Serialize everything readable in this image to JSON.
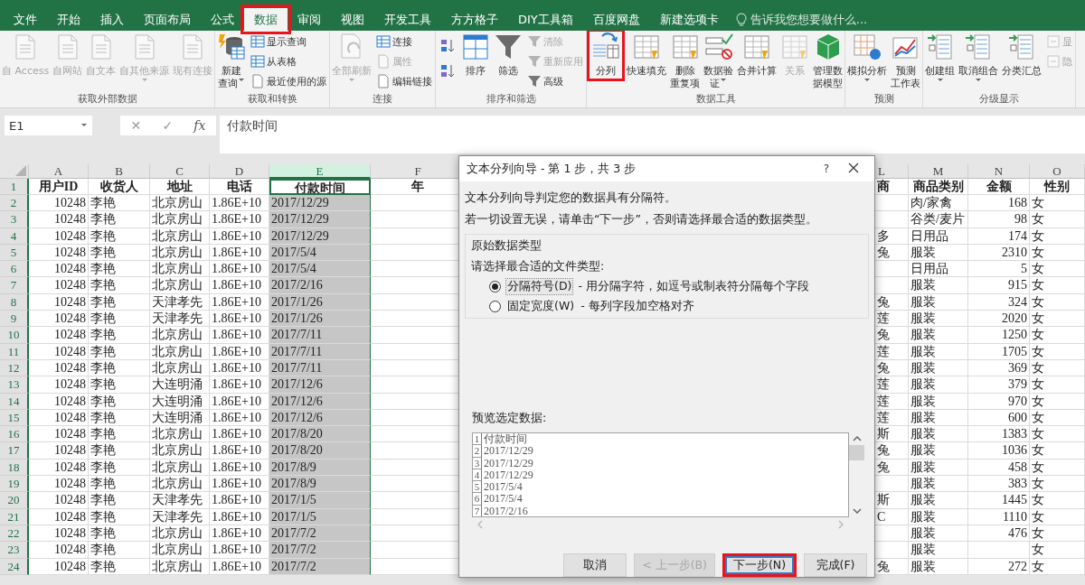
{
  "tabs": [
    {
      "label": "文件",
      "selected": false,
      "highlighted": false
    },
    {
      "label": "开始",
      "selected": false,
      "highlighted": false
    },
    {
      "label": "插入",
      "selected": false,
      "highlighted": false
    },
    {
      "label": "页面布局",
      "selected": false,
      "highlighted": false
    },
    {
      "label": "公式",
      "selected": false,
      "highlighted": false
    },
    {
      "label": "数据",
      "selected": true,
      "highlighted": true
    },
    {
      "label": "审阅",
      "selected": false,
      "highlighted": false
    },
    {
      "label": "视图",
      "selected": false,
      "highlighted": false
    },
    {
      "label": "开发工具",
      "selected": false,
      "highlighted": false
    },
    {
      "label": "方方格子",
      "selected": false,
      "highlighted": false
    },
    {
      "label": "DIY工具箱",
      "selected": false,
      "highlighted": false
    },
    {
      "label": "百度网盘",
      "selected": false,
      "highlighted": false
    },
    {
      "label": "新建选项卡",
      "selected": false,
      "highlighted": false
    }
  ],
  "tell_me": {
    "placeholder": "告诉我您想要做什么..."
  },
  "ribbon": {
    "groups": [
      {
        "label": "获取外部数据",
        "items": [
          {
            "kind": "large",
            "lines": [
              "自 Access"
            ],
            "disabled": true
          },
          {
            "kind": "large",
            "lines": [
              "自网站"
            ],
            "disabled": true
          },
          {
            "kind": "large",
            "lines": [
              "自文本"
            ],
            "disabled": true
          },
          {
            "kind": "large",
            "lines": [
              "自其他来源"
            ],
            "disabled": true,
            "menu": true
          },
          {
            "kind": "large",
            "lines": [
              "现有连接"
            ],
            "disabled": true
          }
        ]
      },
      {
        "label": "获取和转换",
        "items": [
          {
            "kind": "large",
            "lines": [
              "新建",
              "查询"
            ],
            "disabled": false,
            "menu": true
          },
          {
            "kind": "stack",
            "items": [
              {
                "label": "显示查询",
                "disabled": false
              },
              {
                "label": "从表格",
                "disabled": false
              },
              {
                "label": "最近使用的源",
                "disabled": false
              }
            ]
          }
        ]
      },
      {
        "label": "连接",
        "items": [
          {
            "kind": "large",
            "lines": [
              "全部刷新"
            ],
            "disabled": true,
            "menu": true
          },
          {
            "kind": "stack",
            "items": [
              {
                "label": "连接",
                "disabled": false
              },
              {
                "label": "属性",
                "disabled": true
              },
              {
                "label": "编辑链接",
                "disabled": false
              }
            ]
          }
        ]
      },
      {
        "label": "排序和筛选",
        "items": [
          {
            "kind": "sort-icons"
          },
          {
            "kind": "large",
            "lines": [
              "排序"
            ],
            "disabled": false
          },
          {
            "kind": "large",
            "lines": [
              "筛选"
            ],
            "disabled": false
          },
          {
            "kind": "stack",
            "items": [
              {
                "label": "清除",
                "disabled": true
              },
              {
                "label": "重新应用",
                "disabled": true
              },
              {
                "label": "高级",
                "disabled": false
              }
            ]
          }
        ]
      },
      {
        "label": "数据工具",
        "items": [
          {
            "kind": "large",
            "lines": [
              "分列"
            ],
            "disabled": false,
            "highlighted": true
          },
          {
            "kind": "large",
            "lines": [
              "快速填充"
            ],
            "disabled": false
          },
          {
            "kind": "large",
            "lines": [
              "删除",
              "重复项"
            ],
            "disabled": false
          },
          {
            "kind": "large",
            "lines": [
              "数据验",
              "证"
            ],
            "disabled": false,
            "menu": true
          },
          {
            "kind": "large",
            "lines": [
              "合并计算"
            ],
            "disabled": false
          },
          {
            "kind": "large",
            "lines": [
              "关系"
            ],
            "disabled": true
          },
          {
            "kind": "large",
            "lines": [
              "管理数",
              "据模型"
            ],
            "disabled": false
          }
        ]
      },
      {
        "label": "预测",
        "items": [
          {
            "kind": "large",
            "lines": [
              "模拟分析"
            ],
            "disabled": false,
            "menu": true
          },
          {
            "kind": "large",
            "lines": [
              "预测",
              "工作表"
            ],
            "disabled": false
          }
        ]
      },
      {
        "label": "分级显示",
        "items": [
          {
            "kind": "large",
            "lines": [
              "创建组"
            ],
            "disabled": false,
            "menu": true
          },
          {
            "kind": "large",
            "lines": [
              "取消组合"
            ],
            "disabled": false,
            "menu": true
          },
          {
            "kind": "large",
            "lines": [
              "分类汇总"
            ],
            "disabled": false
          },
          {
            "kind": "stack",
            "items": [
              {
                "label": "显",
                "disabled": true
              },
              {
                "label": "隐",
                "disabled": true
              }
            ]
          }
        ]
      }
    ]
  },
  "formula_bar": {
    "name_box": "E1",
    "cancel": "✕",
    "enter": "✓",
    "function": "fx",
    "value": "付款时间"
  },
  "sheet": {
    "columns": [
      {
        "letter": "A",
        "selected": false,
        "numeric": true
      },
      {
        "letter": "B",
        "selected": false
      },
      {
        "letter": "C",
        "selected": false
      },
      {
        "letter": "D",
        "selected": false
      },
      {
        "letter": "E",
        "selected": true
      },
      {
        "letter": "F",
        "selected": false
      },
      {
        "letter": "L",
        "selected": false,
        "cut_off": true
      },
      {
        "letter": "M",
        "selected": false
      },
      {
        "letter": "N",
        "selected": false,
        "numeric": true
      },
      {
        "letter": "O",
        "selected": false
      }
    ],
    "rows": [
      {
        "number": "1",
        "kind": "header",
        "cells": [
          "用户ID",
          "收货人",
          "地址",
          "电话",
          "付款时间",
          "年",
          "商",
          "商品类别",
          "金额",
          "性别"
        ]
      },
      {
        "number": "2",
        "kind": "data",
        "cells": [
          "10248",
          "李艳",
          "北京房山",
          "1.86E+10",
          "2017/12/29",
          null,
          null,
          "肉/家禽",
          "168",
          "女"
        ]
      },
      {
        "number": "3",
        "kind": "data",
        "cells": [
          "10248",
          "李艳",
          "北京房山",
          "1.86E+10",
          "2017/12/29",
          null,
          null,
          "谷类/麦片",
          "98",
          "女"
        ]
      },
      {
        "number": "4",
        "kind": "data",
        "cells": [
          "10248",
          "李艳",
          "北京房山",
          "1.86E+10",
          "2017/12/29",
          null,
          "多",
          "日用品",
          "174",
          "女"
        ]
      },
      {
        "number": "5",
        "kind": "data",
        "cells": [
          "10248",
          "李艳",
          "北京房山",
          "1.86E+10",
          "2017/5/4",
          null,
          "兔",
          "服装",
          "2310",
          "女"
        ]
      },
      {
        "number": "6",
        "kind": "data",
        "cells": [
          "10248",
          "李艳",
          "北京房山",
          "1.86E+10",
          "2017/5/4",
          null,
          null,
          "日用品",
          "5",
          "女"
        ]
      },
      {
        "number": "7",
        "kind": "data",
        "cells": [
          "10248",
          "李艳",
          "北京房山",
          "1.86E+10",
          "2017/2/16",
          null,
          null,
          "服装",
          "915",
          "女"
        ]
      },
      {
        "number": "8",
        "kind": "data",
        "cells": [
          "10248",
          "李艳",
          "天津孝先",
          "1.86E+10",
          "2017/1/26",
          null,
          "兔",
          "服装",
          "324",
          "女"
        ]
      },
      {
        "number": "9",
        "kind": "data",
        "cells": [
          "10248",
          "李艳",
          "天津孝先",
          "1.86E+10",
          "2017/1/26",
          null,
          "莲",
          "服装",
          "2020",
          "女"
        ]
      },
      {
        "number": "10",
        "kind": "data",
        "cells": [
          "10248",
          "李艳",
          "北京房山",
          "1.86E+10",
          "2017/7/11",
          null,
          "兔",
          "服装",
          "1250",
          "女"
        ]
      },
      {
        "number": "11",
        "kind": "data",
        "cells": [
          "10248",
          "李艳",
          "北京房山",
          "1.86E+10",
          "2017/7/11",
          null,
          "莲",
          "服装",
          "1705",
          "女"
        ]
      },
      {
        "number": "12",
        "kind": "data",
        "cells": [
          "10248",
          "李艳",
          "北京房山",
          "1.86E+10",
          "2017/7/11",
          null,
          "兔",
          "服装",
          "369",
          "女"
        ]
      },
      {
        "number": "13",
        "kind": "data",
        "cells": [
          "10248",
          "李艳",
          "大连明涌",
          "1.86E+10",
          "2017/12/6",
          null,
          "莲",
          "服装",
          "379",
          "女"
        ]
      },
      {
        "number": "14",
        "kind": "data",
        "cells": [
          "10248",
          "李艳",
          "大连明涌",
          "1.86E+10",
          "2017/12/6",
          null,
          "莲",
          "服装",
          "970",
          "女"
        ]
      },
      {
        "number": "15",
        "kind": "data",
        "cells": [
          "10248",
          "李艳",
          "大连明涌",
          "1.86E+10",
          "2017/12/6",
          null,
          "莲",
          "服装",
          "600",
          "女"
        ]
      },
      {
        "number": "16",
        "kind": "data",
        "cells": [
          "10248",
          "李艳",
          "北京房山",
          "1.86E+10",
          "2017/8/20",
          null,
          "斯",
          "服装",
          "1383",
          "女"
        ]
      },
      {
        "number": "17",
        "kind": "data",
        "cells": [
          "10248",
          "李艳",
          "北京房山",
          "1.86E+10",
          "2017/8/20",
          null,
          "兔",
          "服装",
          "1036",
          "女"
        ]
      },
      {
        "number": "18",
        "kind": "data",
        "cells": [
          "10248",
          "李艳",
          "北京房山",
          "1.86E+10",
          "2017/8/9",
          null,
          "兔",
          "服装",
          "458",
          "女"
        ]
      },
      {
        "number": "19",
        "kind": "data",
        "cells": [
          "10248",
          "李艳",
          "北京房山",
          "1.86E+10",
          "2017/8/9",
          null,
          null,
          "服装",
          "383",
          "女"
        ]
      },
      {
        "number": "20",
        "kind": "data",
        "cells": [
          "10248",
          "李艳",
          "天津孝先",
          "1.86E+10",
          "2017/1/5",
          null,
          "斯",
          "服装",
          "1445",
          "女"
        ]
      },
      {
        "number": "21",
        "kind": "data",
        "cells": [
          "10248",
          "李艳",
          "天津孝先",
          "1.86E+10",
          "2017/1/5",
          null,
          "C",
          "服装",
          "1110",
          "女"
        ]
      },
      {
        "number": "22",
        "kind": "data",
        "cells": [
          "10248",
          "李艳",
          "北京房山",
          "1.86E+10",
          "2017/7/2",
          null,
          null,
          "服装",
          "476",
          "女"
        ]
      },
      {
        "number": "23",
        "kind": "data",
        "cells": [
          "10248",
          "李艳",
          "北京房山",
          "1.86E+10",
          "2017/7/2",
          null,
          null,
          "服装",
          null,
          "女"
        ]
      },
      {
        "number": "24",
        "kind": "data",
        "cells": [
          "10248",
          "李艳",
          "北京房山",
          "1.86E+10",
          "2017/7/2",
          null,
          "兔",
          "服装",
          "272",
          "女"
        ]
      }
    ]
  },
  "dialog": {
    "title": "文本分列向导 - 第 1 步，共 3 步",
    "help": "?",
    "intro": "文本分列向导判定您的数据具有分隔符。",
    "instruction": "若一切设置无误，请单击“下一步”，否则请选择最合适的数据类型。",
    "group_title": "原始数据类型",
    "prompt": "请选择最合适的文件类型:",
    "options": [
      {
        "label": "分隔符号(D)",
        "description": "- 用分隔字符，如逗号或制表符分隔每个字段",
        "selected": true
      },
      {
        "label": "固定宽度(W)",
        "description": "- 每列字段加空格对齐",
        "selected": false
      }
    ],
    "preview_label": "预览选定数据:",
    "preview_rows": [
      {
        "number": "1",
        "text": "付款时间"
      },
      {
        "number": "2",
        "text": "2017/12/29"
      },
      {
        "number": "3",
        "text": "2017/12/29"
      },
      {
        "number": "4",
        "text": "2017/12/29"
      },
      {
        "number": "5",
        "text": "2017/5/4"
      },
      {
        "number": "6",
        "text": "2017/5/4"
      },
      {
        "number": "7",
        "text": "2017/2/16"
      }
    ],
    "buttons": [
      {
        "label": "取消",
        "disabled": false,
        "default": false,
        "highlighted": false
      },
      {
        "label": "< 上一步(B)",
        "disabled": true,
        "default": false,
        "highlighted": false
      },
      {
        "label": "下一步(N)",
        "disabled": false,
        "default": true,
        "highlighted": true
      },
      {
        "label": "完成(F)",
        "disabled": false,
        "default": false,
        "highlighted": false
      }
    ]
  }
}
